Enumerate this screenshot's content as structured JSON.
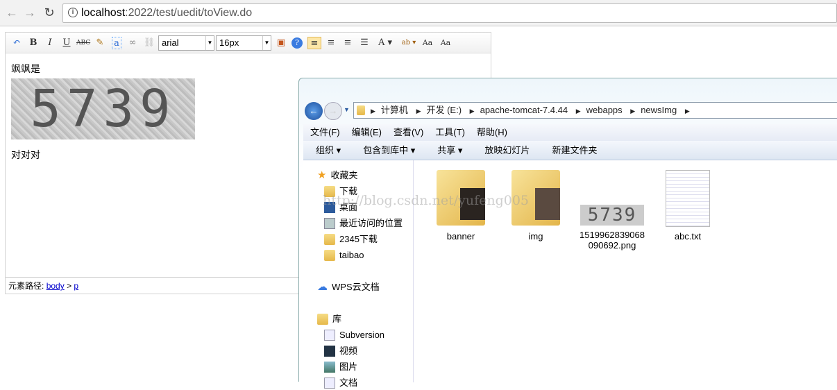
{
  "browser": {
    "url_host": "localhost",
    "url_rest": ":2022/test/uedit/toView.do"
  },
  "editor": {
    "font_family": "arial",
    "font_size": "16px",
    "toolbar": [
      "undo-icon",
      "bold-icon",
      "italic-icon",
      "underline-icon",
      "strikethrough-icon",
      "clear-format-icon",
      "text-box-icon",
      "link-icon",
      "unlink-icon"
    ],
    "content": {
      "line1": "飒飒是",
      "captcha_text": "5739",
      "line2": "对对对"
    },
    "path_label": "元素路径:",
    "path_body": "body",
    "path_sep": ">",
    "path_p": "p"
  },
  "explorer": {
    "breadcrumb": [
      "计算机",
      "开发 (E:)",
      "apache-tomcat-7.4.44",
      "webapps",
      "newsImg"
    ],
    "menu": [
      "文件(F)",
      "编辑(E)",
      "查看(V)",
      "工具(T)",
      "帮助(H)"
    ],
    "commands": [
      "组织 ▾",
      "包含到库中 ▾",
      "共享 ▾",
      "放映幻灯片",
      "新建文件夹"
    ],
    "nav": {
      "favorites": "收藏夹",
      "fav_items": [
        "下载",
        "桌面",
        "最近访问的位置",
        "2345下载",
        "taibao"
      ],
      "wps": "WPS云文档",
      "library": "库",
      "lib_items": [
        "Subversion",
        "视频",
        "图片",
        "文档"
      ]
    },
    "files": [
      {
        "name": "banner"
      },
      {
        "name": "img"
      },
      {
        "name": "1519962839068 090692.png",
        "thumb": "5739"
      },
      {
        "name": "abc.txt"
      }
    ]
  },
  "watermark": "http://blog.csdn.net/yufeng005"
}
